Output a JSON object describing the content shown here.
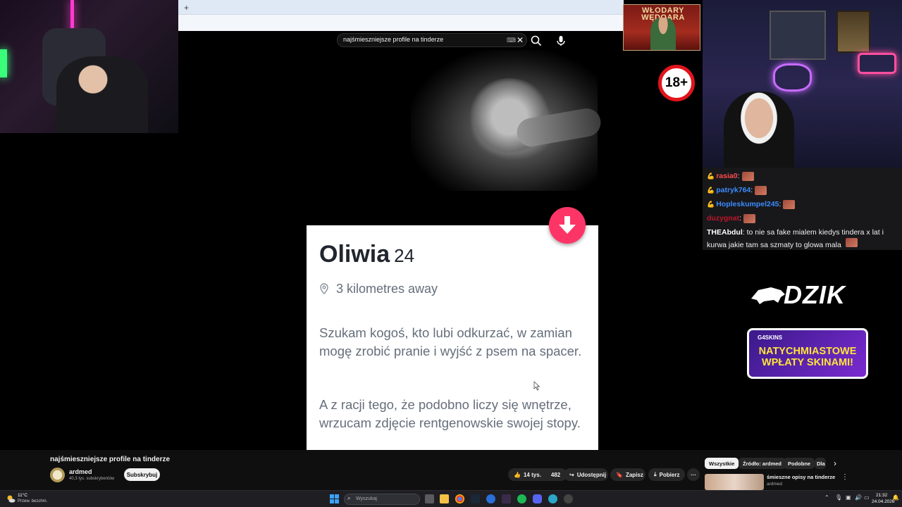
{
  "browser": {
    "new_tab": "+"
  },
  "youtube": {
    "search_query": "najśmieszniejsze profile na tinderze",
    "video_title": "najśmieszniejsze profile na tinderze",
    "channel_name": "ardmed",
    "channel_subs": "40,3 tys. subskrybentów",
    "subscribe": "Subskrybuj",
    "likes": "14 tys.",
    "dislikes": "482",
    "share": "Udostępnij",
    "save": "Zapisz",
    "download": "Pobierz",
    "more": "···",
    "chips": [
      "Wszystkie",
      "Źródło: ardmed",
      "Podobne",
      "Dla"
    ],
    "rec_title": "śmieszne opisy na tinderze",
    "rec_channel": "ardmed",
    "rec_menu": "⋮"
  },
  "profile_card": {
    "name": "Oliwia",
    "age": "24",
    "distance": "3 kilometres away",
    "bio_1": "Szukam kogoś, kto lubi odkurzać, w zamian mogę zrobić pranie i wyjść z psem na spacer.",
    "bio_2": "A z racji tego, że podobno liczy się wnętrze, wrzucam zdjęcie rentgenowskie swojej stopy."
  },
  "age_badge": "18+",
  "banner": {
    "title": "WŁODARY WĘDOARA"
  },
  "chat": [
    {
      "user": "rasia0",
      "message": "",
      "badge": "💪"
    },
    {
      "user": "patryk764",
      "message": "",
      "badge": "💪"
    },
    {
      "user": "Hopleskumpel245",
      "message": "",
      "badge": "💪"
    },
    {
      "user": "duzygnat",
      "message": "",
      "badge": ""
    },
    {
      "user": "THEAbdul",
      "message": "to nie sa fake mialem kiedys tindera x lat i kurwa jakie tam sa szmaty to glowa mala",
      "badge": ""
    }
  ],
  "sponsors": {
    "dzik": "DZIK",
    "promo_brand": "G4SKINS",
    "promo_line1": "NATYCHMIASTOWE",
    "promo_line2": "WPŁATY SKINAMI!"
  },
  "taskbar": {
    "weather_temp": "11°C",
    "weather_desc": "Przew. bezchm.",
    "search_placeholder": "Wyszukaj",
    "time": "21:32",
    "date": "24.04.2026"
  },
  "colors": {
    "tinder_accent": "#fd5068",
    "badge_red": "#e2141c",
    "youtube_bg": "#0f0f0f"
  }
}
